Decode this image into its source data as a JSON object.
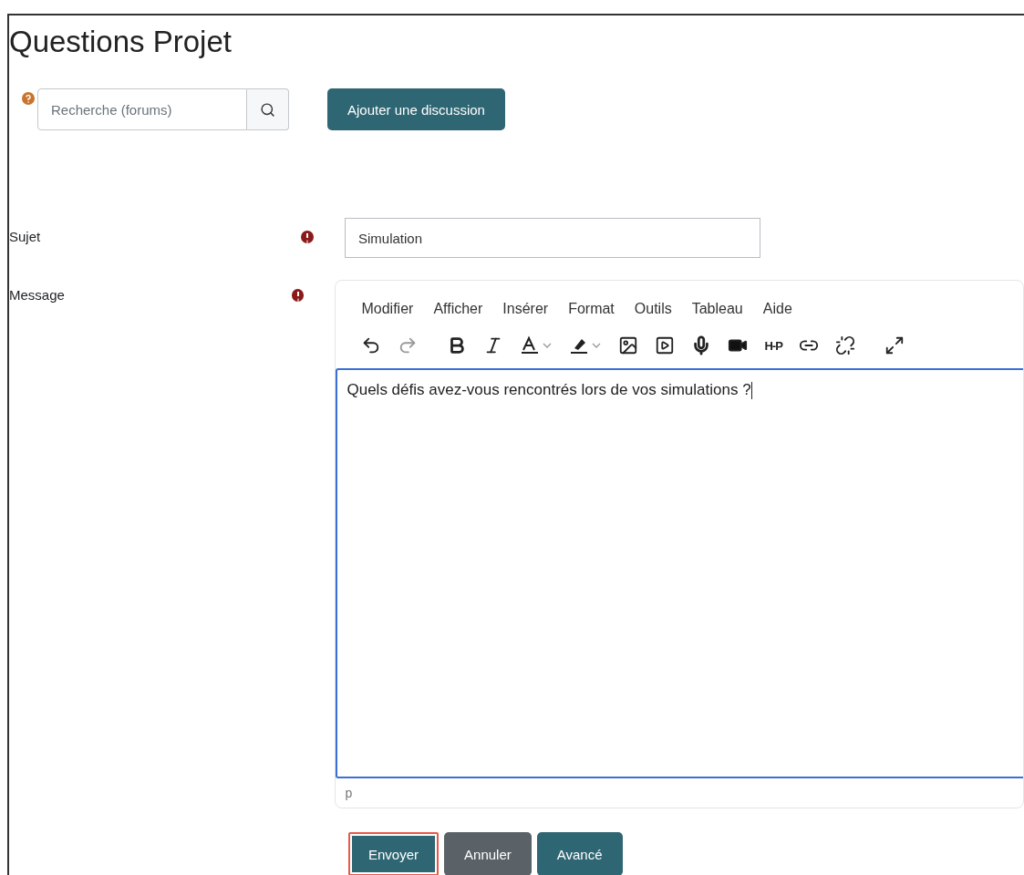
{
  "title": "Questions Projet",
  "search": {
    "placeholder": "Recherche (forums)"
  },
  "add_button": "Ajouter une discussion",
  "form": {
    "subject": {
      "label": "Sujet",
      "required": true,
      "value": "Simulation"
    },
    "message": {
      "label": "Message",
      "required": true,
      "menu": [
        "Modifier",
        "Afficher",
        "Insérer",
        "Format",
        "Outils",
        "Tableau",
        "Aide"
      ],
      "h5p_label": "H-P",
      "value": "Quels défis avez-vous rencontrés lors de vos simulations ?",
      "status_path": "p"
    }
  },
  "buttons": [
    {
      "label": "Envoyer",
      "kind": "primary",
      "focused": true
    },
    {
      "label": "Annuler",
      "kind": "secondary",
      "focused": false
    },
    {
      "label": "Avancé",
      "kind": "primary",
      "focused": false
    }
  ]
}
